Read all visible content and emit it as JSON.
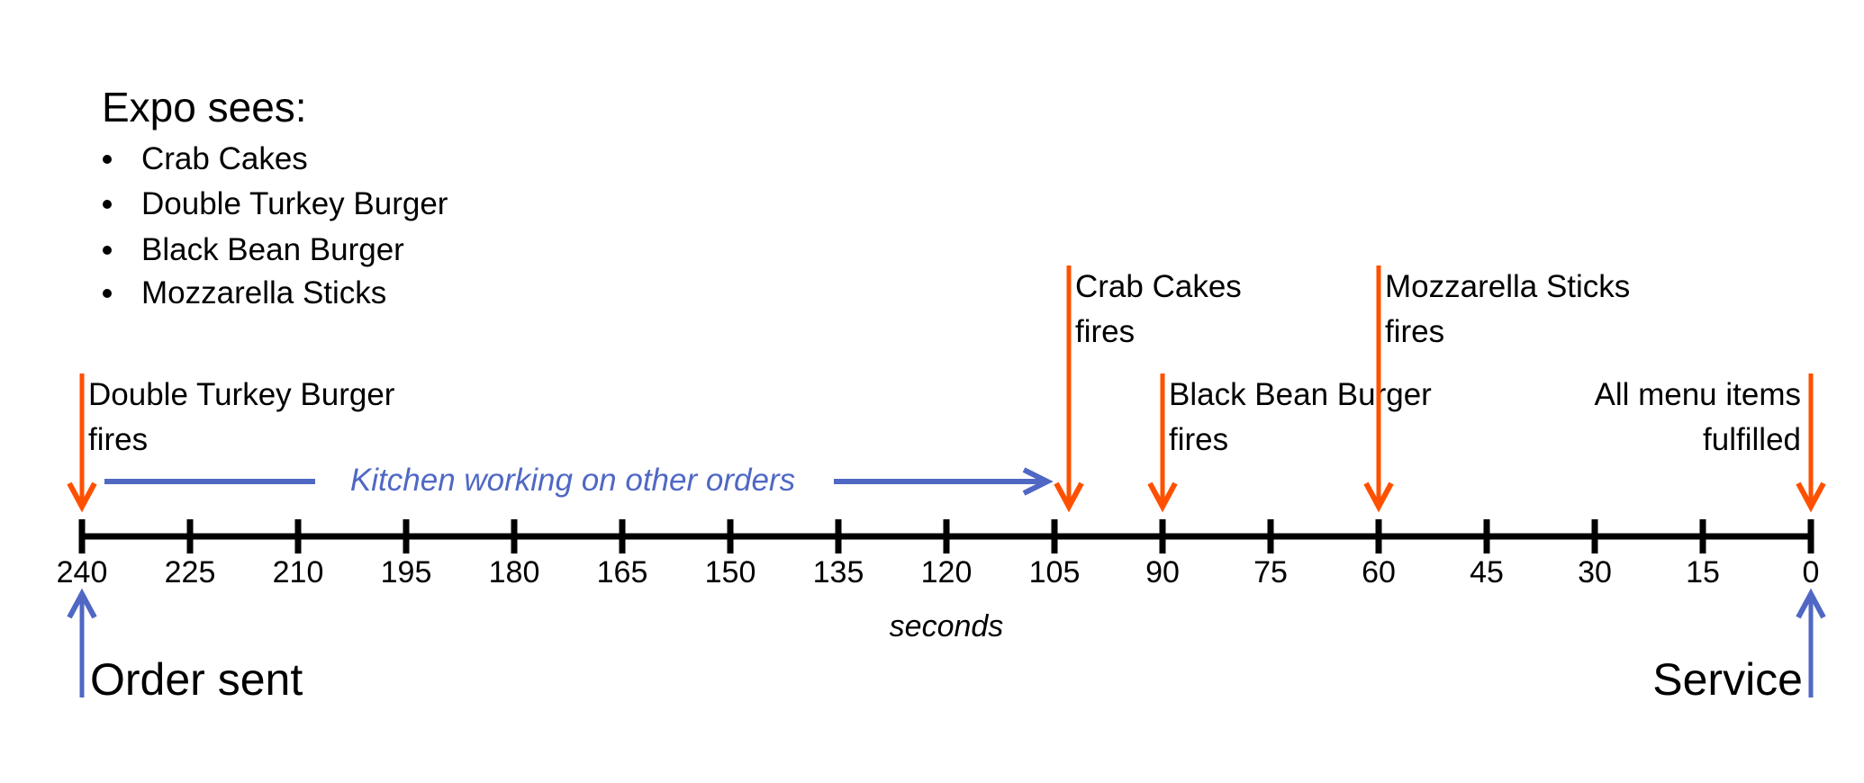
{
  "header": {
    "title": "Expo sees:",
    "items": [
      "Crab Cakes",
      "Double Turkey Burger",
      "Black Bean Burger",
      "Mozzarella Sticks"
    ]
  },
  "colors": {
    "fire_arrow": "#FF5000",
    "kitchen_arrow": "#5068C4",
    "axis": "#000000",
    "text": "#000000"
  },
  "chart_data": {
    "type": "timeline",
    "title": "Expo sees:",
    "xlabel": "seconds",
    "axis_direction": "descending-left-to-right",
    "xlim": [
      240,
      0
    ],
    "tick_step": 15,
    "ticks": [
      "240",
      "225",
      "210",
      "195",
      "180",
      "165",
      "150",
      "135",
      "120",
      "105",
      "90",
      "75",
      "60",
      "45",
      "30",
      "15",
      "0"
    ],
    "events": [
      {
        "t": 240,
        "lines": [
          "Double Turkey Burger",
          "fires"
        ],
        "level": "low",
        "align": "left"
      },
      {
        "t": 103,
        "lines": [
          "Crab Cakes",
          "fires"
        ],
        "level": "high",
        "align": "left"
      },
      {
        "t": 90,
        "lines": [
          "Black Bean Burger",
          "fires"
        ],
        "level": "low",
        "align": "left"
      },
      {
        "t": 60,
        "lines": [
          "Mozzarella Sticks",
          "fires"
        ],
        "level": "high",
        "align": "left"
      },
      {
        "t": 0,
        "lines": [
          "All menu items",
          "fulfilled"
        ],
        "level": "low",
        "align": "right"
      }
    ],
    "span": {
      "from": 240,
      "to": 103,
      "label": "Kitchen working on other orders"
    },
    "endpoints": [
      {
        "t": 240,
        "label": "Order sent",
        "align": "left"
      },
      {
        "t": 0,
        "label": "Service",
        "align": "right"
      }
    ]
  }
}
